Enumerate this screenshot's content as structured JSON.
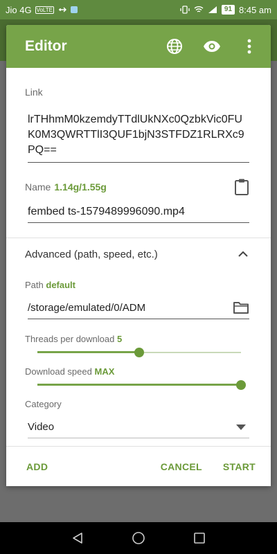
{
  "status_bar": {
    "carrier": "Jio 4G",
    "volte": "VoLTE",
    "battery": "91",
    "time": "8:45 am"
  },
  "toolbar": {
    "title": "Editor",
    "icons": [
      "globe-icon",
      "eye-icon",
      "more-vert-icon"
    ]
  },
  "link": {
    "label": "Link",
    "value": "lrTHhmM0kzemdyTTdlUkNXc0QzbkVic0FUK0M3QWRTTlI3QUF1bjN3STFDZ1RLRXc9PQ=="
  },
  "name": {
    "label": "Name",
    "size": "1.14g/1.55g",
    "value": "fembed ts-1579489996090.mp4"
  },
  "advanced": {
    "label": "Advanced (path, speed, etc.)",
    "expanded": true
  },
  "path": {
    "label": "Path",
    "badge": "default",
    "value": "/storage/emulated/0/ADM"
  },
  "threads": {
    "label": "Threads per download",
    "value": "5",
    "level": 0.5
  },
  "speed": {
    "label": "Download speed",
    "value": "MAX",
    "level": 1.0
  },
  "category": {
    "label": "Category",
    "value": "Video"
  },
  "actions": {
    "add": "ADD",
    "cancel": "CANCEL",
    "start": "START"
  },
  "colors": {
    "accent": "#77a449",
    "accent_text": "#6b9a39",
    "status_bar": "#5f8a3f"
  }
}
